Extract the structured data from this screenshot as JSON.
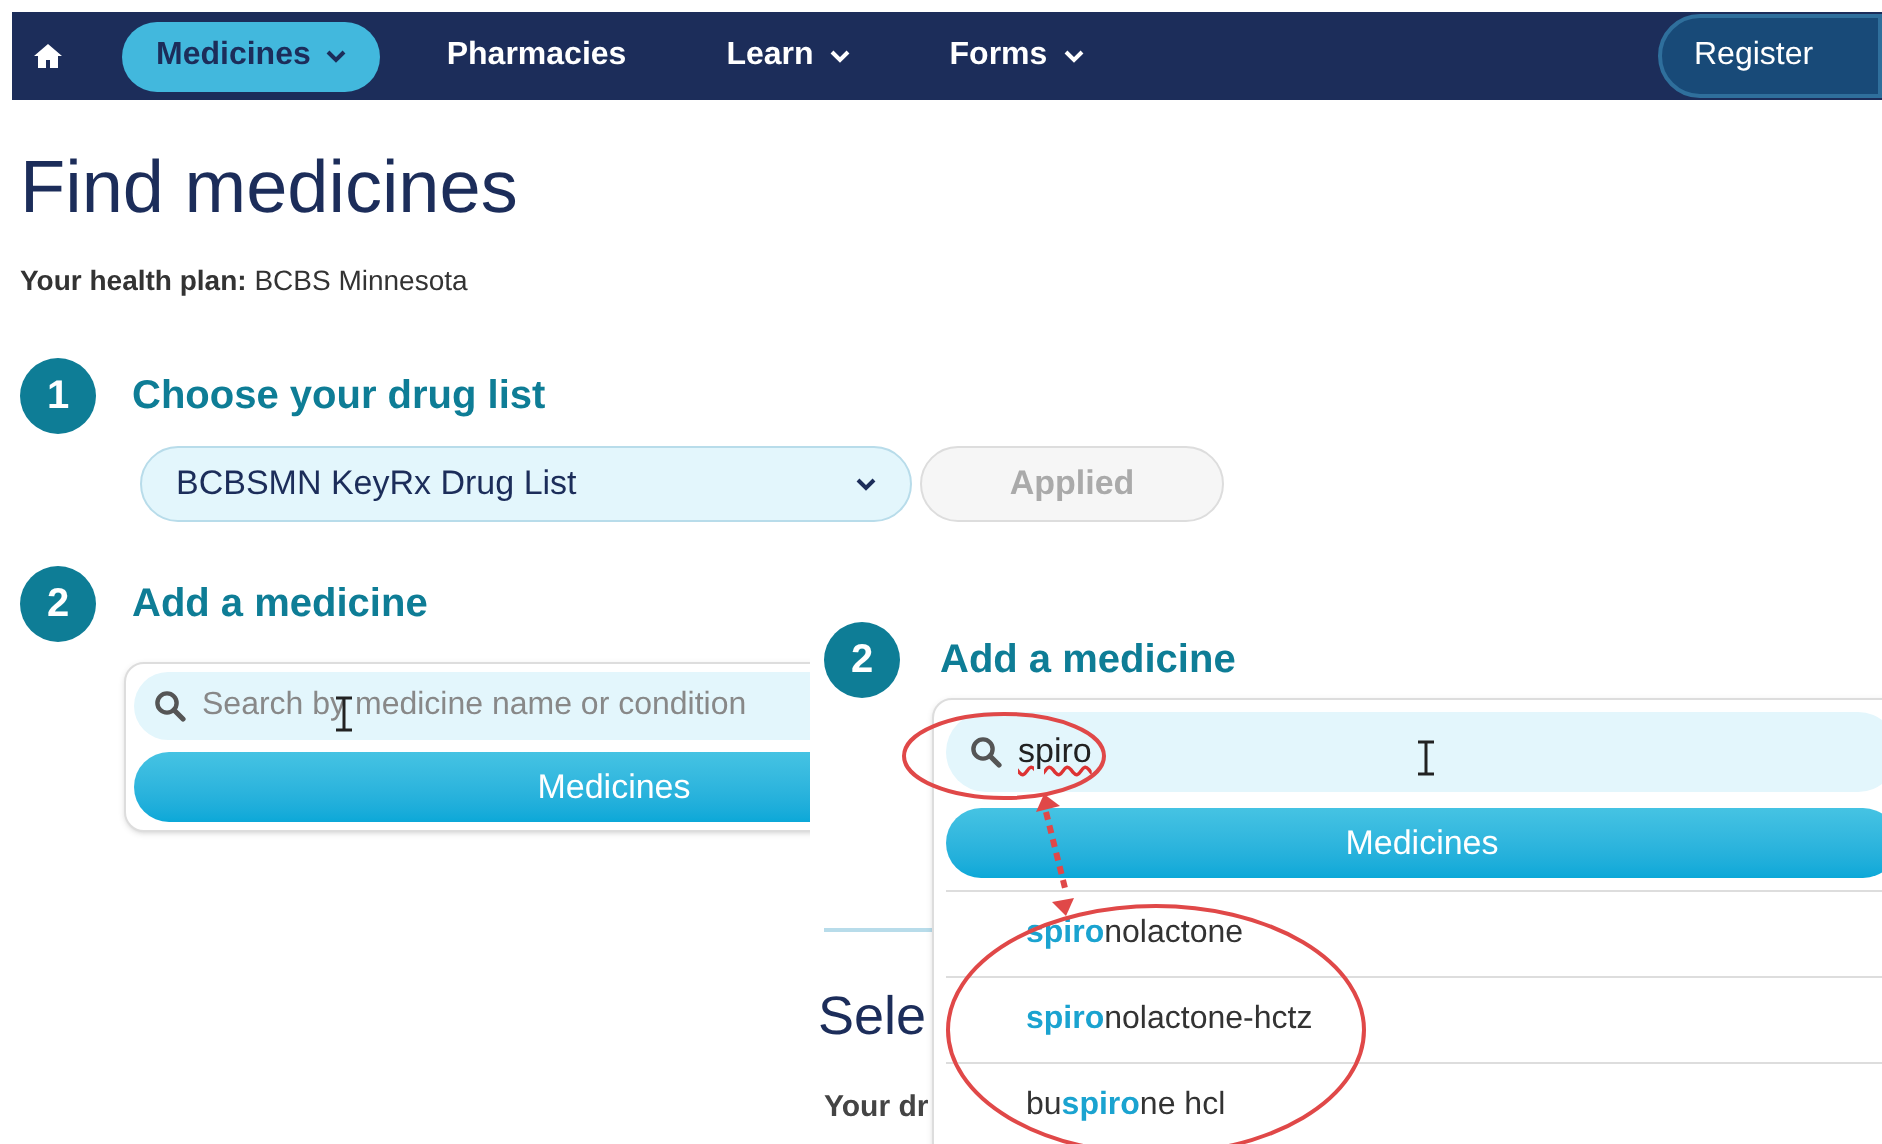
{
  "nav": {
    "items": [
      {
        "label": "Medicines",
        "selected": true,
        "dropdown": true
      },
      {
        "label": "Pharmacies",
        "selected": false,
        "dropdown": false
      },
      {
        "label": "Learn",
        "selected": false,
        "dropdown": true
      },
      {
        "label": "Forms",
        "selected": false,
        "dropdown": true
      }
    ],
    "register": "Register"
  },
  "title": "Find medicines",
  "health_plan": "**Your health plan:** BCBS Minnesota",
  "steps": [
    {
      "number": "1",
      "heading": "Choose your drug list",
      "select_value": "BCBSMN KeyRx Drug List",
      "apply_button": "Applied",
      "apply_disabled": true
    },
    {
      "number": "2",
      "heading": "Add a medicine",
      "placeholder": "Search by medicine name or condition",
      "button": "Medicines"
    }
  ],
  "inset": {
    "number": "2",
    "heading": "Add a medicine",
    "value": "spiro",
    "button": "Medicines",
    "suggestions": [
      "**spiro**nolactone",
      "**spiro**nolactone-hctz",
      "bu**spiro**ne hcl"
    ],
    "behind_heading": "Sele",
    "behind_text": "Your dr"
  }
}
